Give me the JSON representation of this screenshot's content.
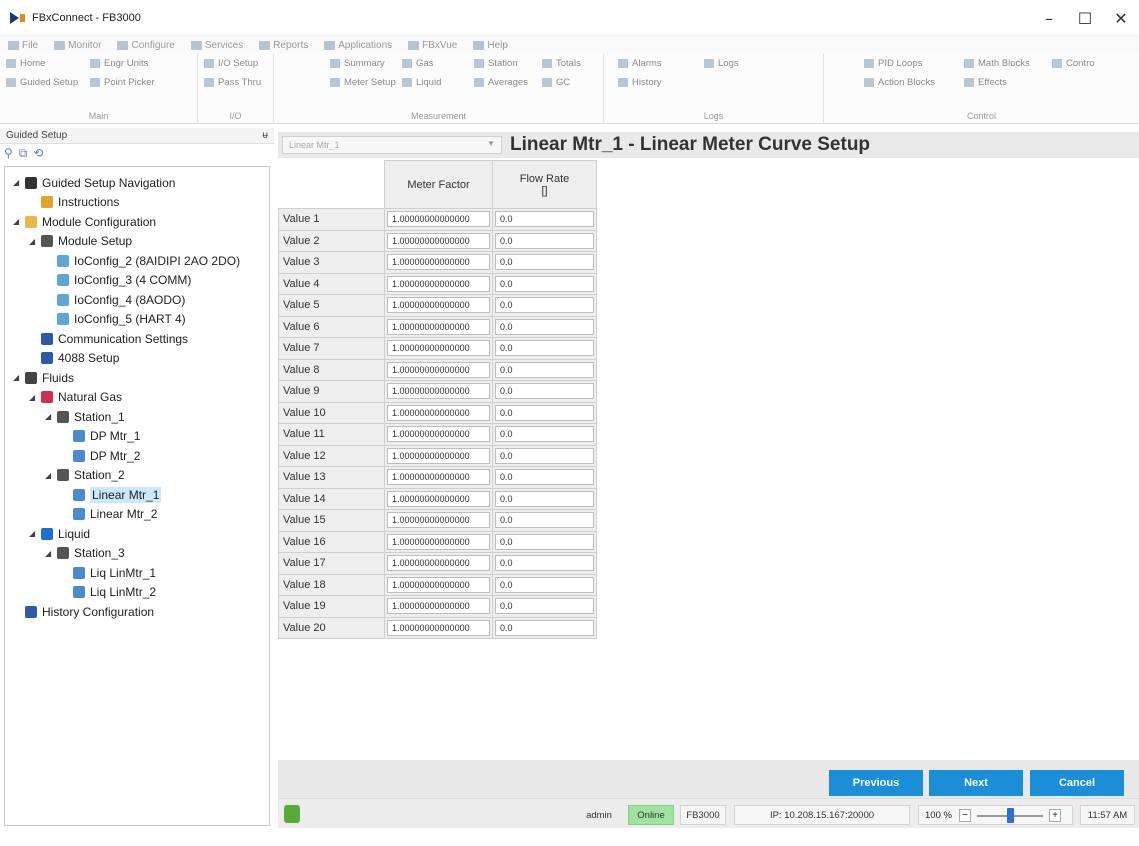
{
  "window": {
    "title": "FBxConnect - FB3000"
  },
  "menu": [
    "File",
    "Monitor",
    "Configure",
    "Services",
    "Reports",
    "Applications",
    "FBxVue",
    "Help"
  ],
  "ribbon": {
    "main": {
      "label": "Main",
      "items": [
        "Home",
        "Engr Units",
        "Guided Setup",
        "Point Picker"
      ]
    },
    "io": {
      "label": "I/O",
      "items": [
        "I/O Setup",
        "Pass Thru"
      ]
    },
    "measurement": {
      "label": "Measurement",
      "items": [
        "Summary",
        "Gas",
        "Station",
        "Totals",
        "Meter Setup",
        "Liquid",
        "Averages",
        "GC"
      ]
    },
    "logs": {
      "label": "Logs",
      "items": [
        "Alarms",
        "Logs",
        "History"
      ]
    },
    "control": {
      "label": "Control",
      "items": [
        "PID Loops",
        "Math Blocks",
        "Contro",
        "Action Blocks",
        "Effects"
      ]
    }
  },
  "left_panel": {
    "title": "Guided Setup",
    "pin": "ᵾ",
    "tree": [
      {
        "label": "Guided Setup Navigation",
        "indent": 0,
        "expander": "◢",
        "icon": "#333333"
      },
      {
        "label": "Instructions",
        "indent": 1,
        "expander": "",
        "icon": "#e0a42a"
      },
      {
        "label": "Module Configuration",
        "indent": 0,
        "expander": "◢",
        "icon": "#e7b84a"
      },
      {
        "label": "Module Setup",
        "indent": 1,
        "expander": "◢",
        "icon": "#555555"
      },
      {
        "label": "IoConfig_2 (8AIDIPI 2AO 2DO)",
        "indent": 2,
        "expander": "",
        "icon": "#5fa6d6"
      },
      {
        "label": "IoConfig_3 (4 COMM)",
        "indent": 2,
        "expander": "",
        "icon": "#5fa6d6"
      },
      {
        "label": "IoConfig_4 (8AODO)",
        "indent": 2,
        "expander": "",
        "icon": "#5fa6d6"
      },
      {
        "label": "IoConfig_5 (HART 4)",
        "indent": 2,
        "expander": "",
        "icon": "#5fa6d6"
      },
      {
        "label": "Communication Settings",
        "indent": 1,
        "expander": "",
        "icon": "#2a5aa8"
      },
      {
        "label": "4088 Setup",
        "indent": 1,
        "expander": "",
        "icon": "#2a5aa8"
      },
      {
        "label": "Fluids",
        "indent": 0,
        "expander": "◢",
        "icon": "#444444"
      },
      {
        "label": "Natural Gas",
        "indent": 1,
        "expander": "◢",
        "icon": "#d0304f"
      },
      {
        "label": "Station_1",
        "indent": 2,
        "expander": "◢",
        "icon": "#555555"
      },
      {
        "label": "DP Mtr_1",
        "indent": 3,
        "expander": "",
        "icon": "#4a8bd0"
      },
      {
        "label": "DP Mtr_2",
        "indent": 3,
        "expander": "",
        "icon": "#4a8bd0"
      },
      {
        "label": "Station_2",
        "indent": 2,
        "expander": "◢",
        "icon": "#555555"
      },
      {
        "label": "Linear Mtr_1",
        "indent": 3,
        "expander": "",
        "icon": "#4a8bd0",
        "selected": true
      },
      {
        "label": "Linear Mtr_2",
        "indent": 3,
        "expander": "",
        "icon": "#4a8bd0"
      },
      {
        "label": "Liquid",
        "indent": 1,
        "expander": "◢",
        "icon": "#1a6fd1"
      },
      {
        "label": "Station_3",
        "indent": 2,
        "expander": "◢",
        "icon": "#555555"
      },
      {
        "label": "Liq LinMtr_1",
        "indent": 3,
        "expander": "",
        "icon": "#4a8bd0"
      },
      {
        "label": "Liq LinMtr_2",
        "indent": 3,
        "expander": "",
        "icon": "#4a8bd0"
      },
      {
        "label": "History Configuration",
        "indent": 0,
        "expander": "",
        "icon": "#2a5aa8"
      }
    ]
  },
  "content": {
    "selector_value": "Linear Mtr_1",
    "title": "Linear Mtr_1 - Linear Meter Curve Setup",
    "columns": [
      "Meter Factor",
      "Flow Rate"
    ],
    "flow_rate_unit": "[]",
    "rows": [
      {
        "label": "Value 1",
        "meter_factor": "1.00000000000000",
        "flow_rate": "0.0"
      },
      {
        "label": "Value 2",
        "meter_factor": "1.00000000000000",
        "flow_rate": "0.0"
      },
      {
        "label": "Value 3",
        "meter_factor": "1.00000000000000",
        "flow_rate": "0.0"
      },
      {
        "label": "Value 4",
        "meter_factor": "1.00000000000000",
        "flow_rate": "0.0"
      },
      {
        "label": "Value 5",
        "meter_factor": "1.00000000000000",
        "flow_rate": "0.0"
      },
      {
        "label": "Value 6",
        "meter_factor": "1.00000000000000",
        "flow_rate": "0.0"
      },
      {
        "label": "Value 7",
        "meter_factor": "1.00000000000000",
        "flow_rate": "0.0"
      },
      {
        "label": "Value 8",
        "meter_factor": "1.00000000000000",
        "flow_rate": "0.0"
      },
      {
        "label": "Value 9",
        "meter_factor": "1.00000000000000",
        "flow_rate": "0.0"
      },
      {
        "label": "Value 10",
        "meter_factor": "1.00000000000000",
        "flow_rate": "0.0"
      },
      {
        "label": "Value 11",
        "meter_factor": "1.00000000000000",
        "flow_rate": "0.0"
      },
      {
        "label": "Value 12",
        "meter_factor": "1.00000000000000",
        "flow_rate": "0.0"
      },
      {
        "label": "Value 13",
        "meter_factor": "1.00000000000000",
        "flow_rate": "0.0"
      },
      {
        "label": "Value 14",
        "meter_factor": "1.00000000000000",
        "flow_rate": "0.0"
      },
      {
        "label": "Value 15",
        "meter_factor": "1.00000000000000",
        "flow_rate": "0.0"
      },
      {
        "label": "Value 16",
        "meter_factor": "1.00000000000000",
        "flow_rate": "0.0"
      },
      {
        "label": "Value 17",
        "meter_factor": "1.00000000000000",
        "flow_rate": "0.0"
      },
      {
        "label": "Value 18",
        "meter_factor": "1.00000000000000",
        "flow_rate": "0.0"
      },
      {
        "label": "Value 19",
        "meter_factor": "1.00000000000000",
        "flow_rate": "0.0"
      },
      {
        "label": "Value 20",
        "meter_factor": "1.00000000000000",
        "flow_rate": "0.0"
      }
    ]
  },
  "buttons": {
    "previous": "Previous",
    "next": "Next",
    "cancel": "Cancel"
  },
  "status": {
    "user": "admin",
    "connection": "Online",
    "device": "FB3000",
    "ip": "IP: 10.208.15.167:20000",
    "zoom": "100 %",
    "zoom_level": 0.5,
    "time": "11:57 AM"
  },
  "colors": {
    "accent": "#1a8fd8",
    "online": "#9ee39e",
    "selection": "#cce8ff"
  }
}
